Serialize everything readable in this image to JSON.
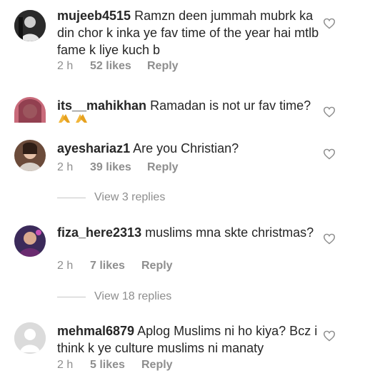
{
  "comments": [
    {
      "username": "mujeeb4515",
      "text": "Ramzn deen jummah mubrk ka din chor k inka ye fav time of the year hai mtlb fame k liye kuch b",
      "time": "2 h",
      "likes": "52 likes",
      "reply": "Reply"
    },
    {
      "username": "its__mahikhan",
      "text": "Ramadan is not ur fav time?",
      "emoji": "praying-hands x2"
    },
    {
      "username": "ayeshariaz1",
      "text": "Are you Christian?",
      "time": "2 h",
      "likes": "39 likes",
      "reply": "Reply",
      "view_replies": "View 3 replies"
    },
    {
      "username": "fiza_here2313",
      "text": "muslims mna skte christmas?",
      "time": "2 h",
      "likes": "7 likes",
      "reply": "Reply",
      "view_replies": "View 18 replies"
    },
    {
      "username": "mehmal6879",
      "text": "Aplog Muslims ni ho kiya? Bcz i think k ye culture muslims ni manaty",
      "time": "2 h",
      "likes": "5 likes",
      "reply": "Reply"
    }
  ],
  "colors": {
    "text": "#262626",
    "secondary": "#8e8e8e",
    "heart_outline": "#8e8e8e"
  },
  "icons": [
    "heart-outline-icon",
    "avatar-placeholder-icon",
    "praying-hands-emoji"
  ]
}
